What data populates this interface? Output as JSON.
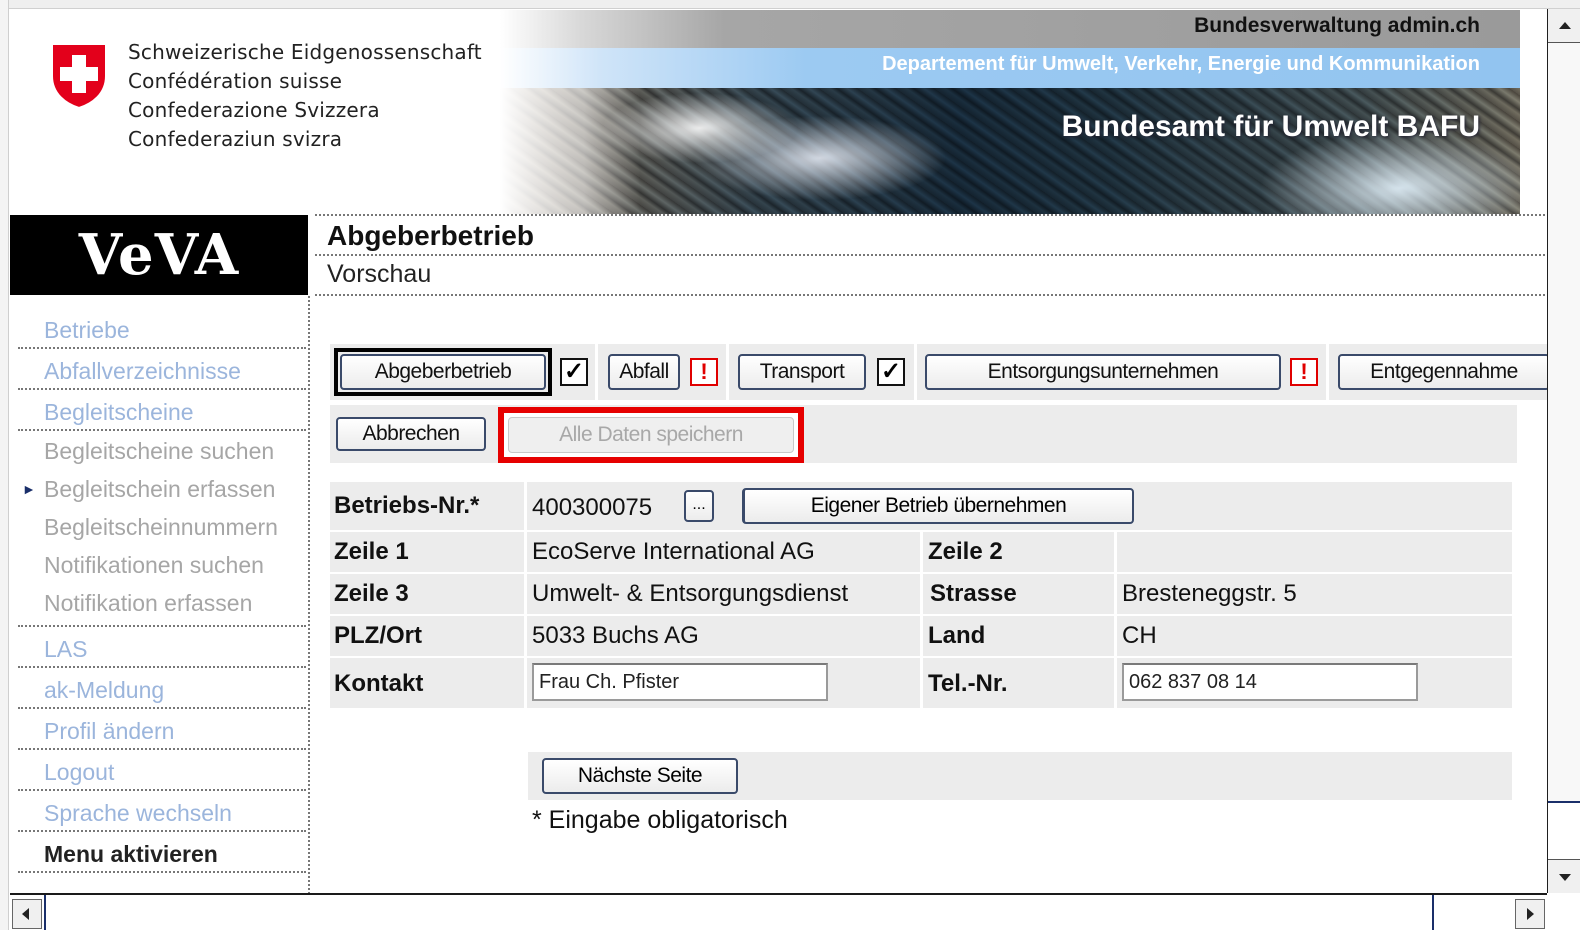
{
  "header": {
    "federation_lines": [
      "Schweizerische Eidgenossenschaft",
      "Confédération suisse",
      "Confederazione Svizzera",
      "Confederaziun svizra"
    ],
    "admin_label": "Bundesverwaltung admin.ch",
    "department": "Departement für Umwelt, Verkehr, Energie und Kommunikation",
    "office": "Bundesamt für Umwelt BAFU"
  },
  "app": {
    "logo": "VeVA"
  },
  "page": {
    "title": "Abgeberbetrieb",
    "subtitle": "Vorschau"
  },
  "sidebar": {
    "items": [
      {
        "label": "Betriebe"
      },
      {
        "label": "Abfallverzeichnisse"
      },
      {
        "label": "Begleitscheine"
      },
      {
        "label": "Begleitscheine suchen"
      },
      {
        "label": "Begleitschein erfassen"
      },
      {
        "label": "Begleitscheinnummern"
      },
      {
        "label": "Notifikationen suchen"
      },
      {
        "label": "Notifikation erfassen"
      },
      {
        "label": "LAS"
      },
      {
        "label": "ak-Meldung"
      },
      {
        "label": "Profil ändern"
      },
      {
        "label": "Logout"
      },
      {
        "label": "Sprache wechseln"
      },
      {
        "label": "Menu aktivieren"
      }
    ]
  },
  "tabs": {
    "abgeber": {
      "label": "Abgeberbetrieb",
      "status": "✓"
    },
    "abfall": {
      "label": "Abfall",
      "status": "!"
    },
    "transport": {
      "label": "Transport",
      "status": "✓"
    },
    "entsorgung": {
      "label": "Entsorgungsunternehmen",
      "status": "!"
    },
    "entgegennahme": {
      "label": "Entgegennahme"
    }
  },
  "actions": {
    "cancel": "Abbrechen",
    "save_all": "Alle Daten speichern"
  },
  "form": {
    "betriebs_nr_label": "Betriebs-Nr.*",
    "betriebs_nr_value": "400300075",
    "lookup_button": "...",
    "own_company_button": "Eigener Betrieb übernehmen",
    "zeile1_label": "Zeile 1",
    "zeile1_value": "EcoServe International AG",
    "zeile2_label": "Zeile 2",
    "zeile2_value": "",
    "zeile3_label": "Zeile 3",
    "zeile3_value": "Umwelt- & Entsorgungsdienst",
    "strasse_label": "Strasse",
    "strasse_value": "Bresteneggstr. 5",
    "plz_label": "PLZ/Ort",
    "plz_value": "5033 Buchs AG",
    "land_label": "Land",
    "land_value": "CH",
    "kontakt_label": "Kontakt",
    "kontakt_value": "Frau Ch. Pfister",
    "tel_label": "Tel.-Nr.",
    "tel_value": "062 837 08 14"
  },
  "footer": {
    "next_page": "Nächste Seite",
    "mandatory_note": "* Eingabe obligatorisch"
  },
  "colors": {
    "nav_link": "#9bb5dc",
    "warning_red": "#e60000",
    "row_gray": "#ececec"
  },
  "icons": [
    "swiss-coat-of-arms-icon",
    "check-icon",
    "warning-icon",
    "scroll-up-icon",
    "scroll-down-icon",
    "scroll-left-icon",
    "scroll-right-icon"
  ]
}
